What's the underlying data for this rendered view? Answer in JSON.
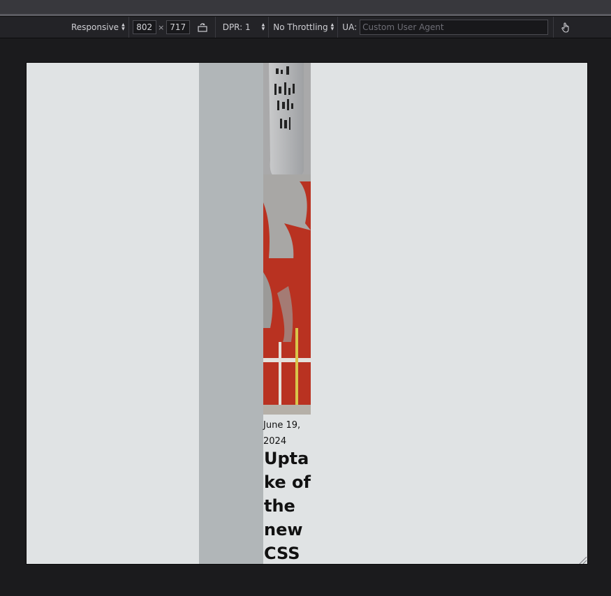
{
  "toolbar": {
    "device_preset": "Responsive",
    "width": "802",
    "times": "×",
    "height": "717",
    "dpr_label": "DPR: 1",
    "throttling": "No Throttling",
    "ua_label": "UA:",
    "ua_placeholder": "Custom User Agent",
    "rotate_icon": "rotate-icon",
    "touch_icon": "touch-hand-icon"
  },
  "viewport": {
    "article": {
      "date": "June 19, 2024",
      "headline": "Uptake of the new CSS"
    }
  },
  "colors": {
    "viewport_bg": "#e0e3e4",
    "gray_column": "#b1b6b8",
    "photo_red": "#b93221"
  }
}
